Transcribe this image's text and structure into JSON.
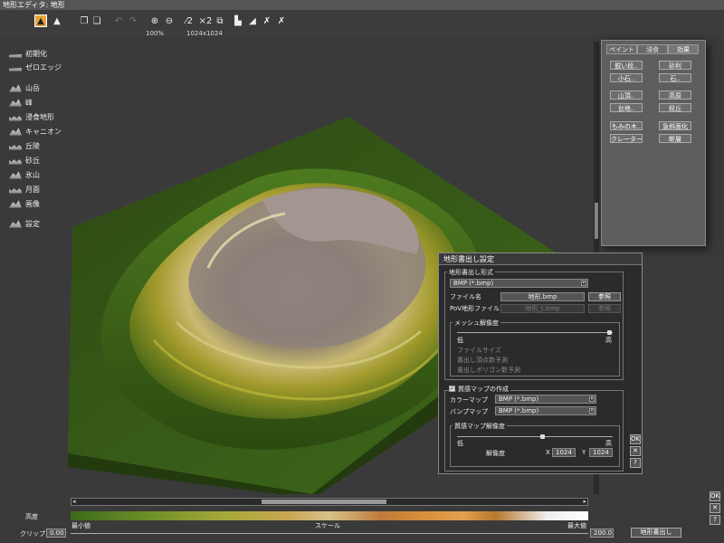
{
  "window": {
    "title": "地形エディタ: 地形"
  },
  "toolbar": {
    "zoom": "100%",
    "resolution": "1024x1024",
    "multiplier": "×2"
  },
  "left_menu": {
    "items": [
      {
        "label": "初期化",
        "icon": "flat-terrain-icon"
      },
      {
        "label": "ゼロエッジ",
        "icon": "zero-edge-icon"
      },
      {
        "label": "山岳",
        "icon": "mountain-icon"
      },
      {
        "label": "峰",
        "icon": "peak-icon"
      },
      {
        "label": "浸食地形",
        "icon": "eroded-terrain-icon"
      },
      {
        "label": "キャニオン",
        "icon": "canyon-icon"
      },
      {
        "label": "丘陵",
        "icon": "hills-icon"
      },
      {
        "label": "砂丘",
        "icon": "dunes-icon"
      },
      {
        "label": "氷山",
        "icon": "iceberg-icon"
      },
      {
        "label": "月面",
        "icon": "lunar-icon"
      },
      {
        "label": "画像",
        "icon": "image-icon"
      },
      {
        "label": "設定",
        "icon": "settings-icon"
      }
    ]
  },
  "panel": {
    "tabs": [
      "ペイント",
      "浸食",
      "効果"
    ],
    "buttons": [
      "鋭い段..",
      "砂利",
      "小石..",
      "石..",
      "山頂..",
      "高原",
      "台地..",
      "段丘",
      "もみの木..",
      "急斜面化",
      "クレーター..",
      "断層"
    ]
  },
  "dialog": {
    "title": "地形書出し設定",
    "format_group": "地形書出し形式",
    "format_value": "BMP (*.bmp)",
    "file_label": "ファイル名",
    "file_value": "地形.bmp",
    "browse": "参照",
    "pov_label": "PoV地形ファイル",
    "pov_value": "地形_t.bmp",
    "mesh_group": "メッシュ解像度",
    "mesh_low": "低",
    "mesh_high": "高",
    "mesh_position": 0.98,
    "file_size_label": "ファイルサイズ",
    "vertex_label": "書出し頂点数予測",
    "polygon_label": "書出しポリゴン数予測",
    "texture_checkbox": "質感マップの作成",
    "texture_checked": true,
    "color_map_label": "カラーマップ",
    "color_map_value": "BMP (*.bmp)",
    "bump_map_label": "バンプマップ",
    "bump_map_value": "BMP (*.bmp)",
    "tex_res_group": "質感マップ解像度",
    "tex_low": "低",
    "tex_high": "高",
    "tex_position": 0.55,
    "resolution_label": "解像度",
    "x_label": "X",
    "x_value": "1024",
    "y_label": "Y",
    "y_value": "1024",
    "ok": "OK",
    "cancel": "✕",
    "help": "?"
  },
  "bottom": {
    "height_label": "高度",
    "min_label": "最小値",
    "scale_label": "スケール",
    "max_label": "最大値",
    "clip_label": "クリップ",
    "clip_min": "0.00",
    "clip_max": "200.0",
    "export_button": "地形書出し"
  },
  "corner": {
    "ok": "OK",
    "cancel": "✕",
    "help": "?"
  }
}
